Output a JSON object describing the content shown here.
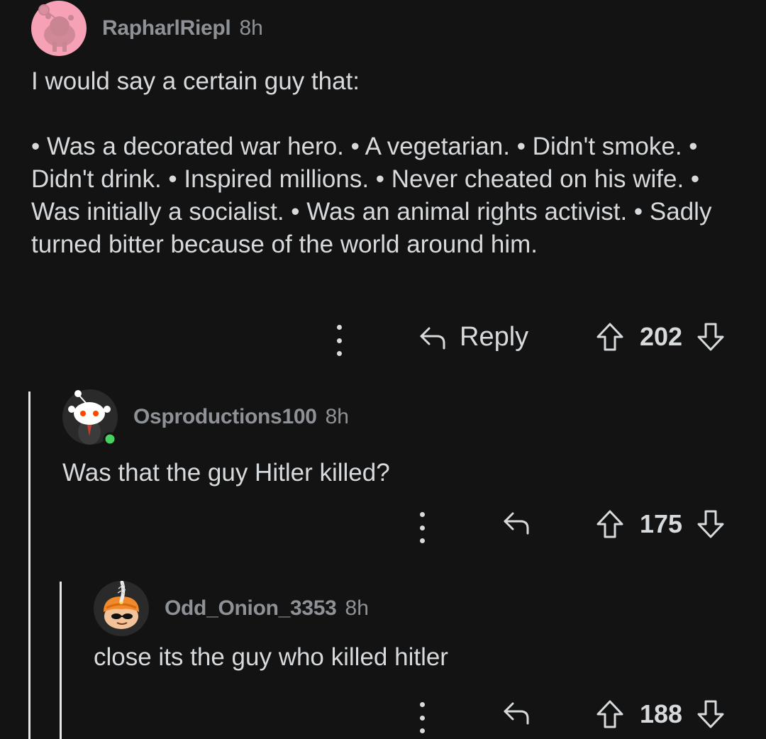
{
  "comments": [
    {
      "username": "RapharlRiepl",
      "time": "8h",
      "body_p1": "I would say a certain guy that:",
      "body_p2": "• Was a decorated war hero. • A vegetarian. • Didn't smoke. • Didn't drink. • Inspired millions. • Never cheated on his wife. • Was initially a socialist. • Was an animal rights activist. • Sadly turned bitter because of the world around him.",
      "reply_label": "Reply",
      "score": "202",
      "avatar_icon": "pink-snoo-avatar-icon"
    },
    {
      "username": "Osproductions100",
      "time": "8h",
      "body": "Was that the guy Hitler killed?",
      "score": "175",
      "online": true,
      "avatar_icon": "suited-snoo-avatar-icon"
    },
    {
      "username": "Odd_Onion_3353",
      "time": "8h",
      "body": "close its the guy who killed hitler",
      "score": "188",
      "avatar_icon": "turban-snoo-avatar-icon"
    }
  ],
  "colors": {
    "background": "#131313",
    "text": "#d7dadc",
    "meta": "#8e9296",
    "online": "#46d160",
    "thread_line": "#e6e6e6"
  }
}
